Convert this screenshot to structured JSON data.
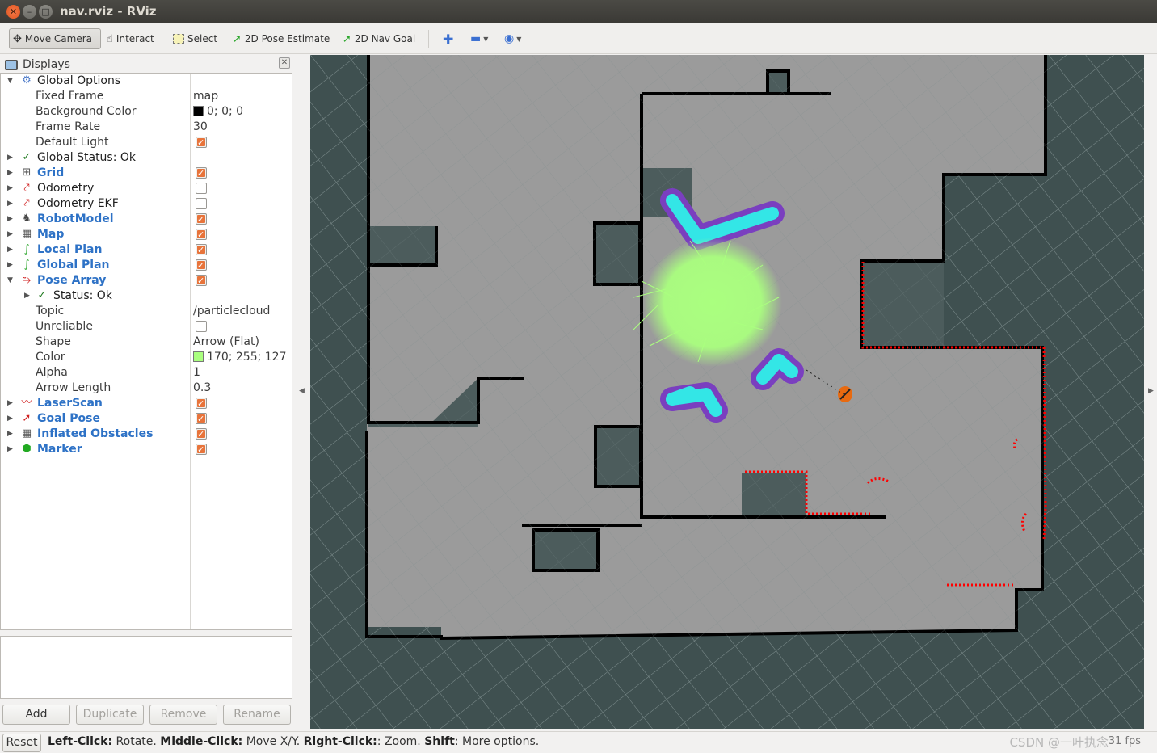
{
  "window": {
    "title": "nav.rviz - RViz"
  },
  "toolbar": {
    "move_camera": "Move Camera",
    "interact": "Interact",
    "select": "Select",
    "pose_estimate": "2D Pose Estimate",
    "nav_goal": "2D Nav Goal"
  },
  "displays": {
    "title": "Displays",
    "global_options": "Global Options",
    "fixed_frame_label": "Fixed Frame",
    "fixed_frame_value": "map",
    "bg_color_label": "Background Color",
    "bg_color_value": "0; 0; 0",
    "frame_rate_label": "Frame Rate",
    "frame_rate_value": "30",
    "default_light_label": "Default Light",
    "global_status": "Global Status: Ok",
    "items": [
      {
        "label": "Grid",
        "checked": true
      },
      {
        "label": "Odometry",
        "checked": false
      },
      {
        "label": "Odometry EKF",
        "checked": false
      },
      {
        "label": "RobotModel",
        "checked": true
      },
      {
        "label": "Map",
        "checked": true
      },
      {
        "label": "Local Plan",
        "checked": true
      },
      {
        "label": "Global Plan",
        "checked": true
      },
      {
        "label": "Pose Array",
        "checked": true
      }
    ],
    "pose_array": {
      "status": "Status: Ok",
      "topic_label": "Topic",
      "topic_value": "/particlecloud",
      "unreliable_label": "Unreliable",
      "shape_label": "Shape",
      "shape_value": "Arrow (Flat)",
      "color_label": "Color",
      "color_value": "170; 255; 127",
      "alpha_label": "Alpha",
      "alpha_value": "1",
      "arrow_length_label": "Arrow Length",
      "arrow_length_value": "0.3"
    },
    "items_after": [
      {
        "label": "LaserScan",
        "checked": true
      },
      {
        "label": "Goal Pose",
        "checked": true
      },
      {
        "label": "Inflated Obstacles",
        "checked": true
      },
      {
        "label": "Marker",
        "checked": true
      }
    ],
    "buttons": {
      "add": "Add",
      "duplicate": "Duplicate",
      "remove": "Remove",
      "rename": "Rename"
    }
  },
  "statusbar": {
    "reset": "Reset",
    "k1": "Left-Click:",
    "v1": " Rotate. ",
    "k2": "Middle-Click:",
    "v2": " Move X/Y. ",
    "k3": "Right-Click:",
    "v3": ": Zoom. ",
    "k4": "Shift",
    "v4": ": More options.",
    "watermark": "CSDN @一叶执念",
    "fps": "31 fps"
  },
  "colors": {
    "accent": "#e8743b",
    "blue_label": "#2e72c6",
    "particle": "#aaff7f",
    "laser": "#ff0000",
    "costmap_cyan": "#33e6e6",
    "costmap_purple": "#7a3fbf"
  }
}
